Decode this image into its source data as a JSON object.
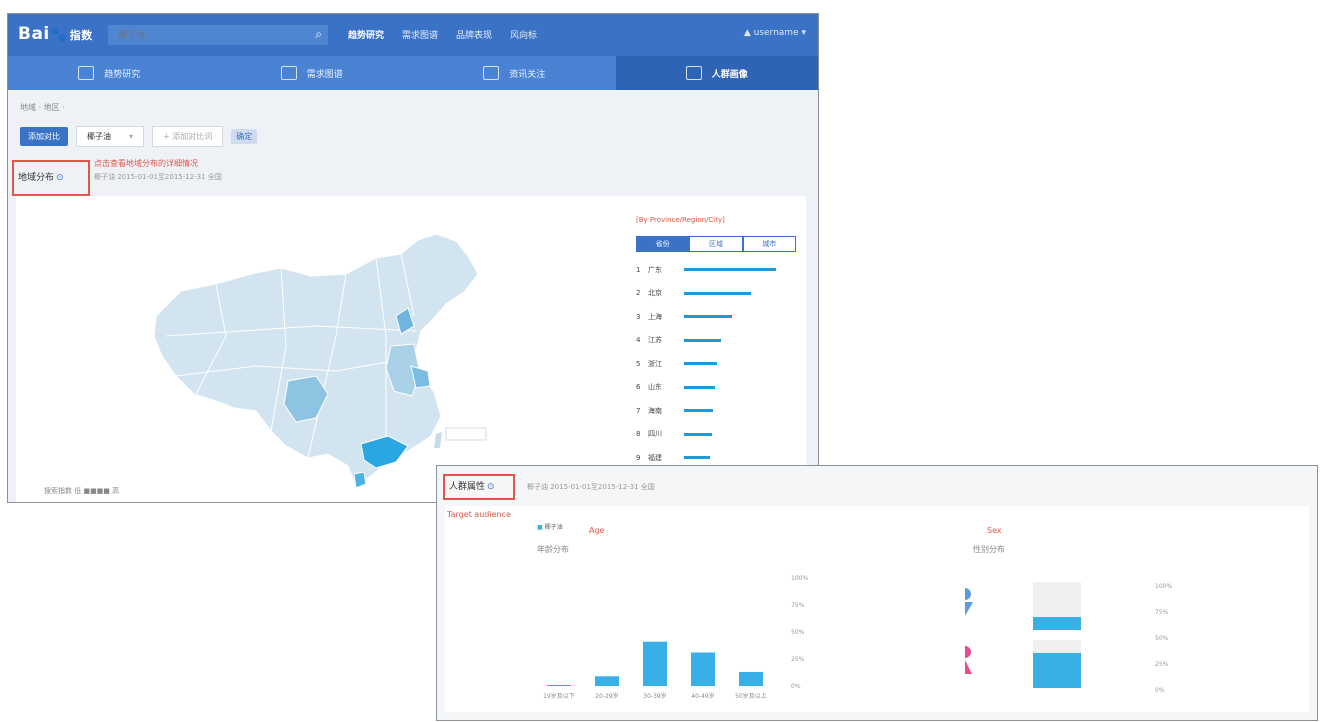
{
  "header": {
    "logo": "Bai",
    "logo_sub": "指数",
    "search_placeholder": "椰子油",
    "nav": [
      "趋势研究",
      "需求图谱",
      "品牌表现",
      "风向标"
    ],
    "active_nav": 0,
    "user": "username"
  },
  "subnav": {
    "tabs": [
      "趋势研究",
      "需求图谱",
      "资讯关注",
      "人群画像"
    ],
    "active": 3
  },
  "breadcrumb": "地域 · 地区 ·",
  "filters": {
    "compare_button": "添加对比",
    "keyword": "椰子油",
    "add_placeholder": "+ 添加对比词",
    "chip": "确定"
  },
  "region_section": {
    "title": "地域分布",
    "red_note": "点击查看地域分布的详细情况",
    "meta": "椰子油  2015-01-01至2015-12-31  全国",
    "legend": "搜索指数 低 ■■■■ 高"
  },
  "ranking": {
    "title": "[By Province/Region/City]",
    "tabs": [
      "省份",
      "区域",
      "城市"
    ],
    "active_tab": 0,
    "rows": [
      {
        "rank": "1",
        "name": "广东",
        "value": 100
      },
      {
        "rank": "2",
        "name": "北京",
        "value": 73
      },
      {
        "rank": "3",
        "name": "上海",
        "value": 52
      },
      {
        "rank": "4",
        "name": "江苏",
        "value": 40
      },
      {
        "rank": "5",
        "name": "浙江",
        "value": 36
      },
      {
        "rank": "6",
        "name": "山东",
        "value": 34
      },
      {
        "rank": "7",
        "name": "海南",
        "value": 32
      },
      {
        "rank": "8",
        "name": "四川",
        "value": 30
      },
      {
        "rank": "9",
        "name": "福建",
        "value": 28
      }
    ]
  },
  "crowd_section": {
    "title": "人群属性",
    "meta": "椰子油  2015-01-01至2015-12-31  全国",
    "red_label": "Target audience",
    "legend": "椰子油",
    "age_red": "Age",
    "gender_red": "Sex",
    "age_title": "年龄分布",
    "gender_title": "性别分布"
  },
  "chart_data": [
    {
      "type": "bar",
      "title": "年龄分布",
      "categories": [
        "19岁及以下",
        "20-29岁",
        "30-39岁",
        "40-49岁",
        "50岁及以上"
      ],
      "series": [
        {
          "name": "椰子油",
          "values": [
            1,
            9,
            41,
            31,
            13
          ]
        }
      ],
      "ylim": [
        0,
        100
      ],
      "yticks": [
        "0%",
        "25%",
        "50%",
        "75%",
        "100%"
      ],
      "bar_color": "#38b0e6"
    },
    {
      "type": "bar",
      "title": "性别分布",
      "categories": [
        "男",
        "女"
      ],
      "series": [
        {
          "name": "椰子油",
          "values": [
            27,
            73
          ]
        }
      ],
      "ylim": [
        0,
        100
      ],
      "yticks": [
        "0%",
        "25%",
        "50%",
        "75%",
        "100%"
      ],
      "colors": {
        "male": "#5b9be0",
        "female": "#e84a8a",
        "bar": "#38b0e6",
        "bar_bg": "#f0f0f0"
      }
    }
  ]
}
